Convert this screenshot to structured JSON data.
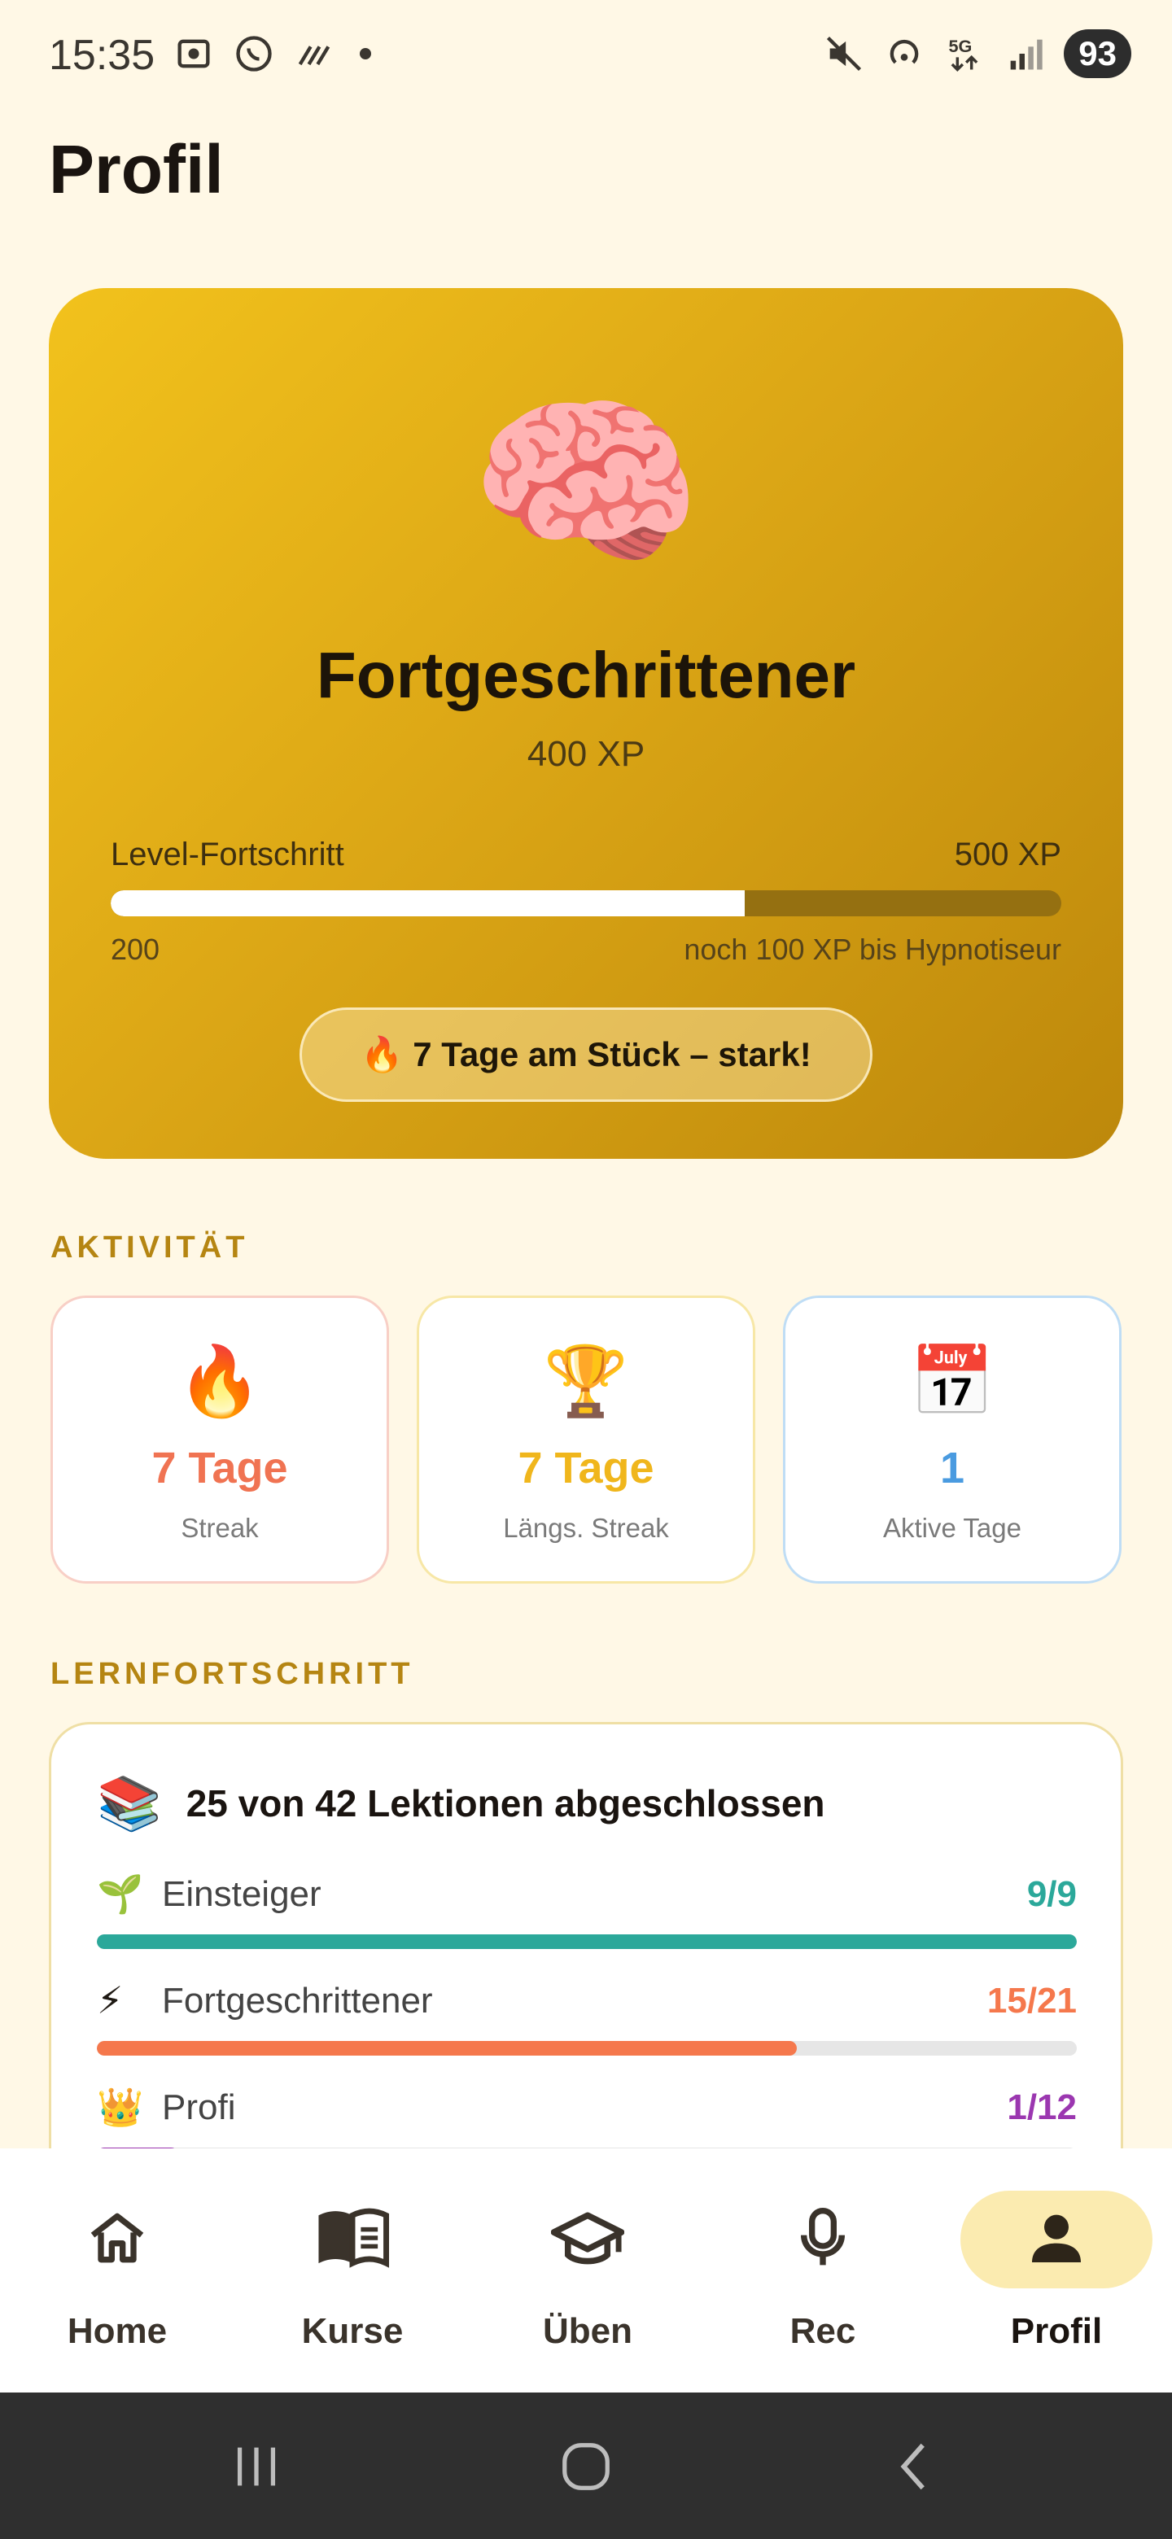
{
  "status_bar": {
    "time": "15:35",
    "battery": "93",
    "icons": [
      "screenshot-icon",
      "whatsapp-icon",
      "signal-slash-icon",
      "mute-icon",
      "hotspot-icon",
      "5g-icon",
      "signal-icon"
    ]
  },
  "page": {
    "title": "Profil"
  },
  "hero": {
    "emoji": "🧠",
    "level_name": "Fortgeschrittener",
    "xp": "400 XP",
    "progress_label": "Level-Fortschritt",
    "progress_max": "500 XP",
    "progress_min": "200",
    "progress_fraction": 0.667,
    "progress_remaining": "noch 100 XP bis Hypnotiseur",
    "streak_text": "🔥 7 Tage am Stück – stark!"
  },
  "activity": {
    "section_title": "AKTIVITÄT",
    "cards": [
      {
        "emoji": "🔥",
        "value": "7 Tage",
        "label": "Streak",
        "color": "#F07352",
        "border": "#F8CFC6"
      },
      {
        "emoji": "🏆",
        "value": "7 Tage",
        "label": "Längs. Streak",
        "color": "#F0B61C",
        "border": "#F7E7A6"
      },
      {
        "emoji": "📅",
        "value": "1",
        "label": "Aktive Tage",
        "color": "#4A9BE0",
        "border": "#BFDDF5"
      }
    ]
  },
  "learning": {
    "section_title": "LERNFORTSCHRITT",
    "emoji": "📚",
    "summary": "25 von 42 Lektionen abgeschlossen",
    "rows": [
      {
        "emoji": "🌱",
        "name": "Einsteiger",
        "count": "9/9",
        "fraction": 1.0,
        "color": "#2BA89A"
      },
      {
        "emoji": "⚡",
        "name": "Fortgeschrittener",
        "count": "15/21",
        "fraction": 0.714,
        "color": "#F5784C"
      },
      {
        "emoji": "👑",
        "name": "Profi",
        "count": "1/12",
        "fraction": 0.083,
        "color": "#9B37B0"
      }
    ]
  },
  "bottom_nav": {
    "items": [
      {
        "label": "Home",
        "icon": "home-icon"
      },
      {
        "label": "Kurse",
        "icon": "book-icon"
      },
      {
        "label": "Üben",
        "icon": "graduation-cap-icon"
      },
      {
        "label": "Rec",
        "icon": "microphone-icon"
      },
      {
        "label": "Profil",
        "icon": "person-icon",
        "active": true
      }
    ]
  },
  "system_nav": {
    "icons": [
      "recents-icon",
      "home-circle-icon",
      "back-icon"
    ]
  }
}
